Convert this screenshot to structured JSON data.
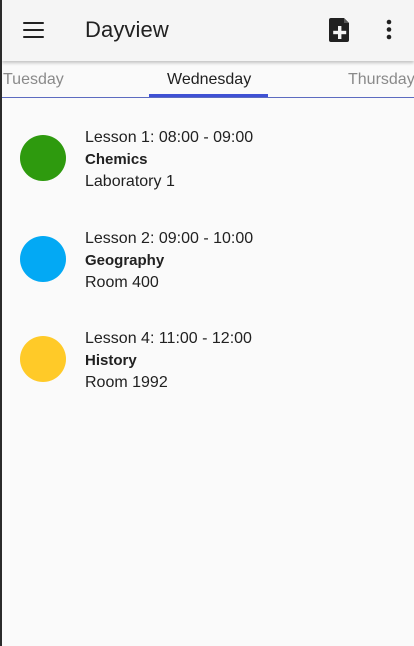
{
  "app_bar": {
    "title": "Dayview",
    "menu_icon": "hamburger-menu-icon",
    "add_icon": "add-document-icon",
    "more_icon": "more-vertical-icon"
  },
  "tabs": {
    "previous": "Tuesday",
    "current": "Wednesday",
    "next": "Thursday",
    "indicator_color": "#3f51d4"
  },
  "lessons": [
    {
      "time": "Lesson 1: 08:00 - 09:00",
      "subject": "Chemics",
      "room": "Laboratory 1",
      "color": "#2e9a0e"
    },
    {
      "time": "Lesson 2: 09:00 - 10:00",
      "subject": "Geography",
      "room": "Room 400",
      "color": "#03a9f4"
    },
    {
      "time": "Lesson 4: 11:00 - 12:00",
      "subject": "History",
      "room": "Room 1992",
      "color": "#ffca28"
    }
  ]
}
